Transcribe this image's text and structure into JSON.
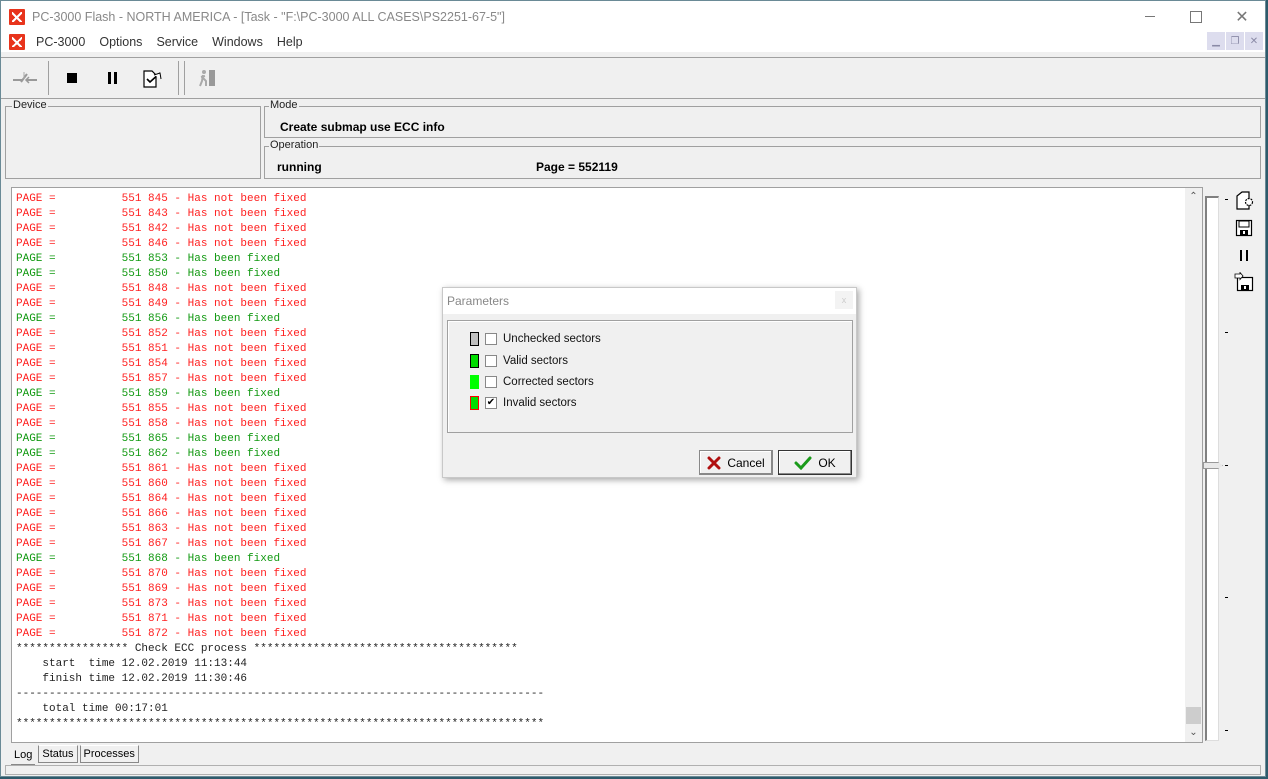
{
  "window": {
    "title": "PC-3000 Flash - NORTH AMERICA - [Task - \"F:\\PC-3000 ALL CASES\\PS2251-67-5\"]",
    "controls": {
      "minimize": "—",
      "maximize": "☐",
      "close": "✕"
    }
  },
  "menubar": {
    "items": [
      "PC-3000",
      "Options",
      "Service",
      "Windows",
      "Help"
    ],
    "mdi_controls": {
      "minimize": "▁",
      "restore": "❐",
      "close": "✕"
    }
  },
  "toolbar": {
    "buttons": [
      {
        "icon": "connect-icon",
        "enabled": false
      },
      {
        "icon": "stop-icon",
        "enabled": true
      },
      {
        "icon": "pause-icon",
        "enabled": true
      },
      {
        "icon": "task-check-icon",
        "enabled": true
      },
      {
        "icon": "exit-icon",
        "enabled": false
      }
    ]
  },
  "panels": {
    "device": {
      "label": "Device",
      "value": ""
    },
    "mode": {
      "label": "Mode",
      "value": "Create submap use ECC info"
    },
    "operation": {
      "label": "Operation",
      "status": "running",
      "page": "Page = 552119"
    }
  },
  "log": {
    "lines": [
      {
        "text": "PAGE =          551 845 - Has not been fixed",
        "color": "red"
      },
      {
        "text": "PAGE =          551 843 - Has not been fixed",
        "color": "red"
      },
      {
        "text": "PAGE =          551 842 - Has not been fixed",
        "color": "red"
      },
      {
        "text": "PAGE =          551 846 - Has not been fixed",
        "color": "red"
      },
      {
        "text": "PAGE =          551 853 - Has been fixed",
        "color": "green"
      },
      {
        "text": "PAGE =          551 850 - Has been fixed",
        "color": "green"
      },
      {
        "text": "PAGE =          551 848 - Has not been fixed",
        "color": "red"
      },
      {
        "text": "PAGE =          551 849 - Has not been fixed",
        "color": "red"
      },
      {
        "text": "PAGE =          551 856 - Has been fixed",
        "color": "green"
      },
      {
        "text": "PAGE =          551 852 - Has not been fixed",
        "color": "red"
      },
      {
        "text": "PAGE =          551 851 - Has not been fixed",
        "color": "red"
      },
      {
        "text": "PAGE =          551 854 - Has not been fixed",
        "color": "red"
      },
      {
        "text": "PAGE =          551 857 - Has not been fixed",
        "color": "red"
      },
      {
        "text": "PAGE =          551 859 - Has been fixed",
        "color": "green"
      },
      {
        "text": "PAGE =          551 855 - Has not been fixed",
        "color": "red"
      },
      {
        "text": "PAGE =          551 858 - Has not been fixed",
        "color": "red"
      },
      {
        "text": "PAGE =          551 865 - Has been fixed",
        "color": "green"
      },
      {
        "text": "PAGE =          551 862 - Has been fixed",
        "color": "green"
      },
      {
        "text": "PAGE =          551 861 - Has not been fixed",
        "color": "red"
      },
      {
        "text": "PAGE =          551 860 - Has not been fixed",
        "color": "red"
      },
      {
        "text": "PAGE =          551 864 - Has not been fixed",
        "color": "red"
      },
      {
        "text": "PAGE =          551 866 - Has not been fixed",
        "color": "red"
      },
      {
        "text": "PAGE =          551 863 - Has not been fixed",
        "color": "red"
      },
      {
        "text": "PAGE =          551 867 - Has not been fixed",
        "color": "red"
      },
      {
        "text": "PAGE =          551 868 - Has been fixed",
        "color": "green"
      },
      {
        "text": "PAGE =          551 870 - Has not been fixed",
        "color": "red"
      },
      {
        "text": "PAGE =          551 869 - Has not been fixed",
        "color": "red"
      },
      {
        "text": "PAGE =          551 873 - Has not been fixed",
        "color": "red"
      },
      {
        "text": "PAGE =          551 871 - Has not been fixed",
        "color": "red"
      },
      {
        "text": "PAGE =          551 872 - Has not been fixed",
        "color": "red"
      },
      {
        "text": "***************** Check ECC process ****************************************",
        "color": "black"
      },
      {
        "text": "    start  time 12.02.2019 11:13:44",
        "color": "black"
      },
      {
        "text": "    finish time 12.02.2019 11:30:46",
        "color": "black"
      },
      {
        "text": "--------------------------------------------------------------------------------",
        "color": "black"
      },
      {
        "text": "    total time 00:17:01",
        "color": "black"
      },
      {
        "text": "********************************************************************************",
        "color": "black"
      }
    ],
    "scroll_position": 1.0
  },
  "side_tools": {
    "icons": [
      "settings-doc-icon",
      "save-icon",
      "pause-icon",
      "save-export-icon"
    ],
    "slider_position": 0.49
  },
  "tabs": [
    {
      "label": "Log",
      "active": true
    },
    {
      "label": "Status",
      "active": false
    },
    {
      "label": "Processes",
      "active": false
    }
  ],
  "dialog": {
    "title": "Parameters",
    "close": "x",
    "options": [
      {
        "label": "Unchecked sectors",
        "checked": false,
        "swatch_fill": "#c0c0c0",
        "swatch_border": "#000000"
      },
      {
        "label": "Valid sectors",
        "checked": false,
        "swatch_fill": "#00dd00",
        "swatch_border": "#000000"
      },
      {
        "label": "Corrected sectors",
        "checked": false,
        "swatch_fill": "#00ff00",
        "swatch_border": "#00ff00"
      },
      {
        "label": "Invalid sectors",
        "checked": true,
        "swatch_fill": "#00dd00",
        "swatch_border": "#ff0000"
      }
    ],
    "cancel_label": "Cancel",
    "ok_label": "OK"
  },
  "colors": {
    "log_error": "#ff2020",
    "log_ok": "#119911",
    "app_logo": "#e8341c"
  }
}
